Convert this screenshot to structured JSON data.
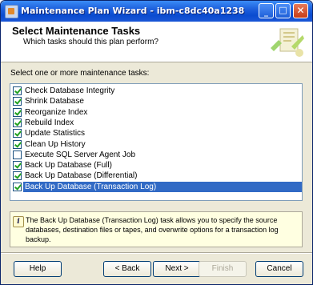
{
  "window": {
    "title": "Maintenance Plan Wizard - ibm-c8dc40a1238"
  },
  "header": {
    "title": "Select Maintenance Tasks",
    "subtitle": "Which tasks should this plan perform?"
  },
  "tasks_label": "Select one or more maintenance tasks:",
  "tasks": [
    {
      "label": "Check Database Integrity",
      "checked": true,
      "selected": false
    },
    {
      "label": "Shrink Database",
      "checked": true,
      "selected": false
    },
    {
      "label": "Reorganize Index",
      "checked": true,
      "selected": false
    },
    {
      "label": "Rebuild Index",
      "checked": true,
      "selected": false
    },
    {
      "label": "Update Statistics",
      "checked": true,
      "selected": false
    },
    {
      "label": "Clean Up History",
      "checked": true,
      "selected": false
    },
    {
      "label": "Execute SQL Server Agent Job",
      "checked": false,
      "selected": false
    },
    {
      "label": "Back Up Database (Full)",
      "checked": true,
      "selected": false
    },
    {
      "label": "Back Up Database (Differential)",
      "checked": true,
      "selected": false
    },
    {
      "label": "Back Up Database (Transaction Log)",
      "checked": true,
      "selected": true
    }
  ],
  "info_text": "The Back Up Database (Transaction Log) task allows you to specify the source databases, destination files or tapes, and overwrite options for a transaction log backup.",
  "buttons": {
    "help": "Help",
    "back": "< Back",
    "next": "Next >",
    "finish": "Finish",
    "cancel": "Cancel"
  },
  "icons": {
    "info": "info-icon",
    "wizard_art": "wizard-illustration-icon"
  }
}
